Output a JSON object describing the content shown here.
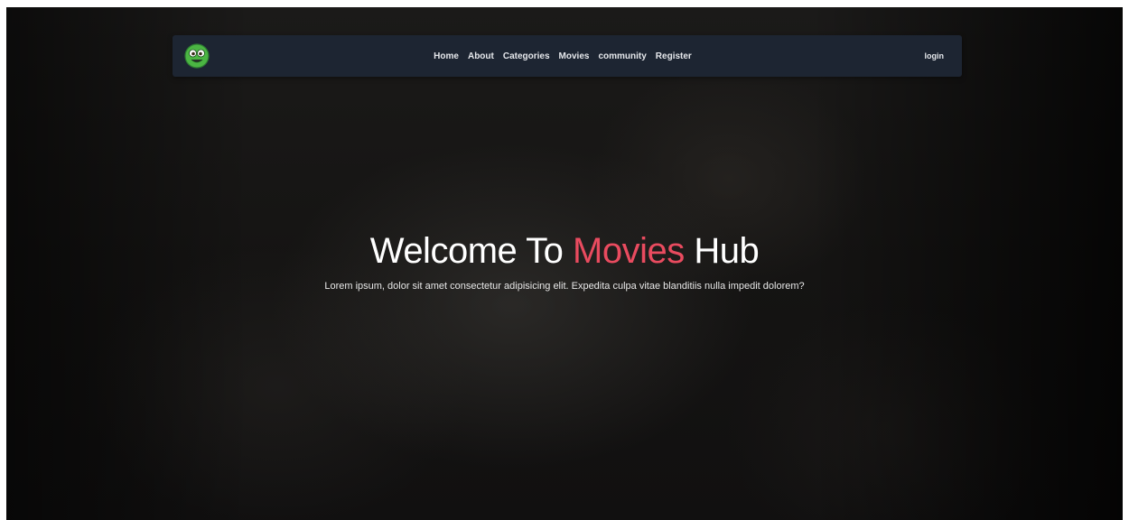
{
  "brand": {
    "logo_icon": "green-smiley-face-icon",
    "logo_color": "#4bb543"
  },
  "nav": {
    "items": [
      {
        "label": "Home"
      },
      {
        "label": "About"
      },
      {
        "label": "Categories"
      },
      {
        "label": "Movies"
      },
      {
        "label": "community"
      },
      {
        "label": "Register"
      }
    ],
    "login_label": "login"
  },
  "hero": {
    "title_part1": "Welcome To ",
    "title_accent": "Movies",
    "title_part2": " Hub",
    "subtitle": "Lorem ipsum, dolor sit amet consectetur adipisicing elit. Expedita culpa vitae blanditiis nulla impedit dolorem?"
  },
  "colors": {
    "accent": "#e94b5f",
    "navbar_bg": "#1d2532",
    "text": "#ffffff"
  }
}
